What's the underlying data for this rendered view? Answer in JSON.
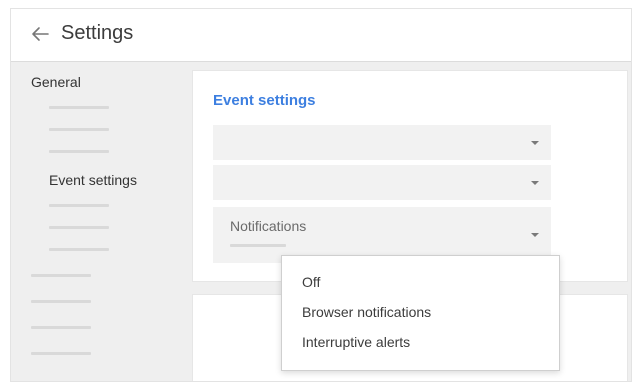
{
  "header": {
    "back_icon": "arrow-left-icon",
    "title": "Settings"
  },
  "sidebar": {
    "general_label": "General",
    "event_settings_label": "Event settings"
  },
  "event_card": {
    "heading": "Event settings",
    "notifications_label": "Notifications",
    "dropdown_icon": "caret-down-icon"
  },
  "notification_menu": {
    "options": [
      "Off",
      "Browser notifications",
      "Interruptive alerts"
    ]
  },
  "colors": {
    "accent": "#3d7fe0",
    "background": "#efefef",
    "surface": "#ffffff"
  }
}
